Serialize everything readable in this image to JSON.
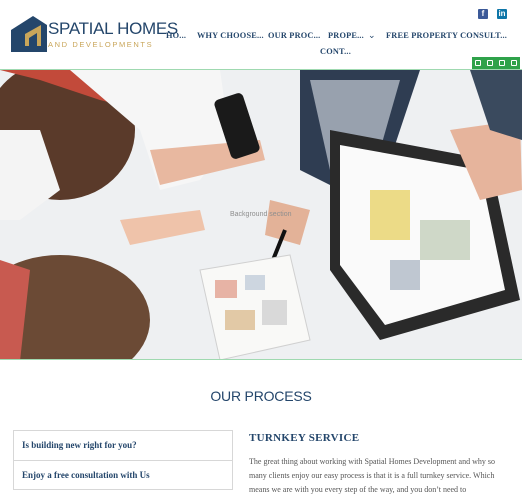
{
  "brand": {
    "name": "SPATIAL HOMES",
    "tagline": "AND DEVELOPMENTS",
    "colors": {
      "navy": "#24466b",
      "gold": "#c9a65a"
    }
  },
  "social": {
    "facebook": {
      "icon": "facebook-icon",
      "glyph": "f"
    },
    "linkedin": {
      "icon": "linkedin-icon",
      "glyph": "in"
    }
  },
  "nav": {
    "items": [
      "HO...",
      "WHY CHOOSE...",
      "OUR PROC...",
      "PROPE...",
      "FREE PROPERTY CONSULT...",
      "CONT..."
    ],
    "dropdown_icon": "chevron-down-icon"
  },
  "editor_tools": [
    "move-icon",
    "settings-icon",
    "copy-icon",
    "delete-icon"
  ],
  "hero": {
    "background_label": "Background section"
  },
  "process": {
    "title": "OUR PROCESS",
    "accordion": [
      "Is building new right for you?",
      "Enjoy a free consultation with Us"
    ],
    "content_title": "TURNKEY SERVICE",
    "content_text": "The great thing about working with Spatial Homes Development and why so many clients enjoy our easy process is that it is a full turnkey service. Which means we are with you every step of the way, and you don’t need to"
  }
}
